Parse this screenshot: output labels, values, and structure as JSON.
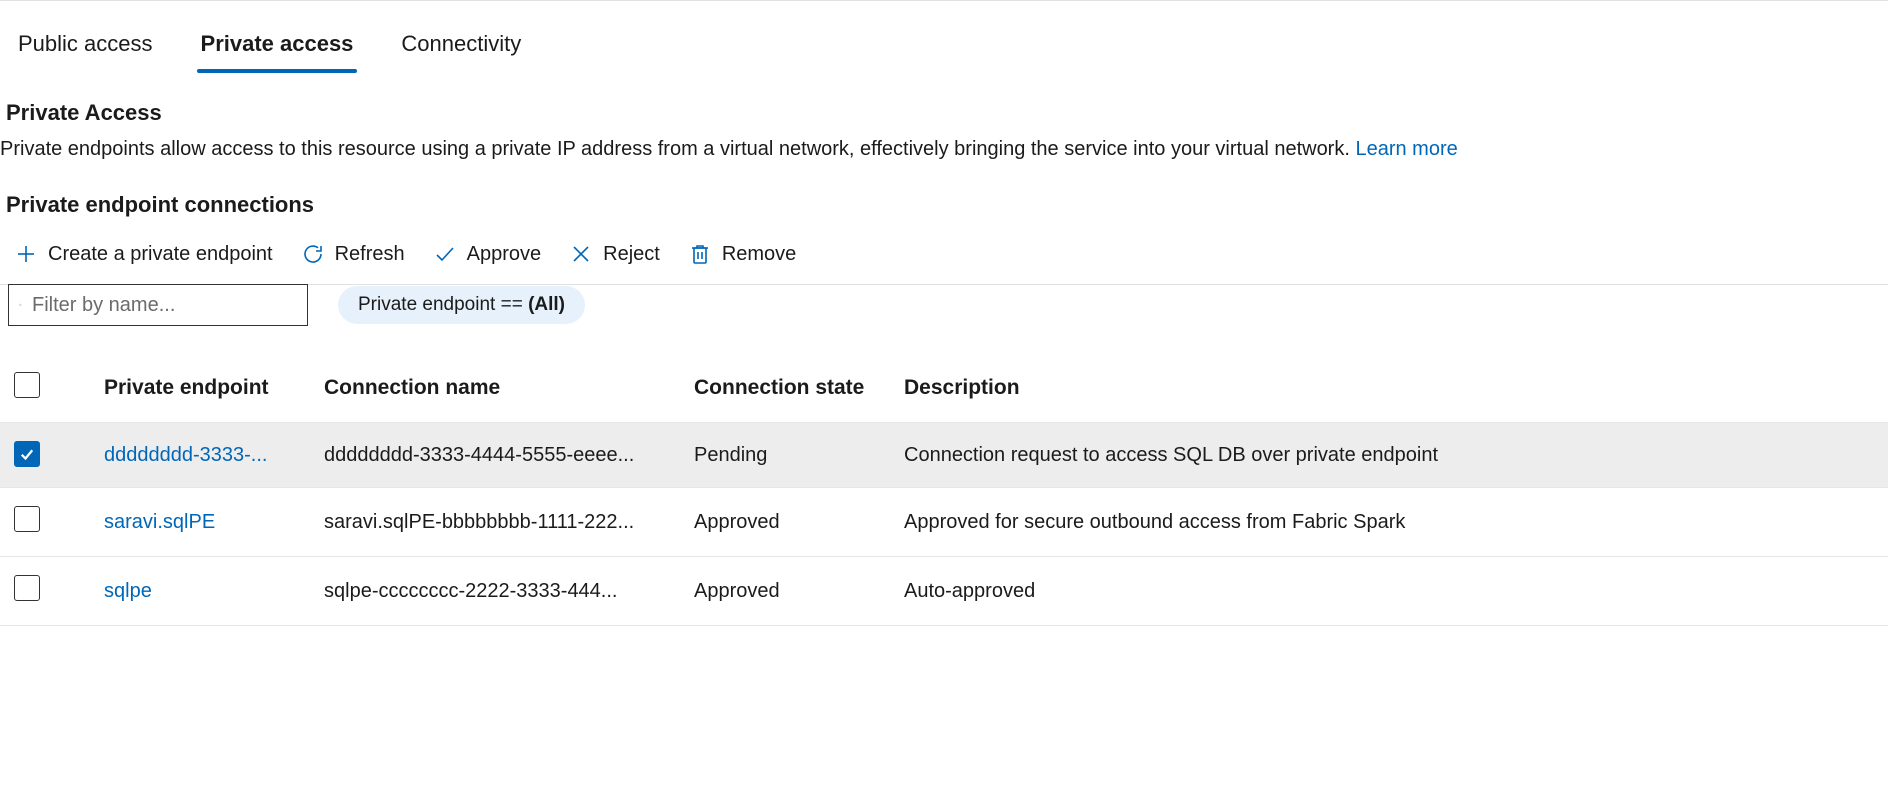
{
  "tabs": [
    {
      "label": "Public access",
      "active": false
    },
    {
      "label": "Private access",
      "active": true
    },
    {
      "label": "Connectivity",
      "active": false
    }
  ],
  "section": {
    "title": "Private Access",
    "description": "Private endpoints allow access to this resource using a private IP address from a virtual network, effectively bringing the service into your virtual network. ",
    "learn_more": "Learn more"
  },
  "subsection_title": "Private endpoint connections",
  "toolbar": {
    "create": "Create a private endpoint",
    "refresh": "Refresh",
    "approve": "Approve",
    "reject": "Reject",
    "remove": "Remove"
  },
  "filter": {
    "placeholder": "Filter by name...",
    "pill_prefix": "Private endpoint == ",
    "pill_value": "(All)"
  },
  "columns": {
    "endpoint": "Private endpoint",
    "connection": "Connection name",
    "state": "Connection state",
    "description": "Description"
  },
  "rows": [
    {
      "checked": true,
      "endpoint": "dddddddd-3333-...",
      "connection": "dddddddd-3333-4444-5555-eeee...",
      "state": "Pending",
      "description": "Connection request to access SQL DB over private endpoint"
    },
    {
      "checked": false,
      "endpoint": "saravi.sqlPE",
      "connection": "saravi.sqlPE-bbbbbbbb-1111-222...",
      "state": "Approved",
      "description": "Approved for secure outbound access from Fabric Spark"
    },
    {
      "checked": false,
      "endpoint": "sqlpe",
      "connection": "sqlpe-cccccccc-2222-3333-444...",
      "state": "Approved",
      "description": "Auto-approved"
    }
  ]
}
